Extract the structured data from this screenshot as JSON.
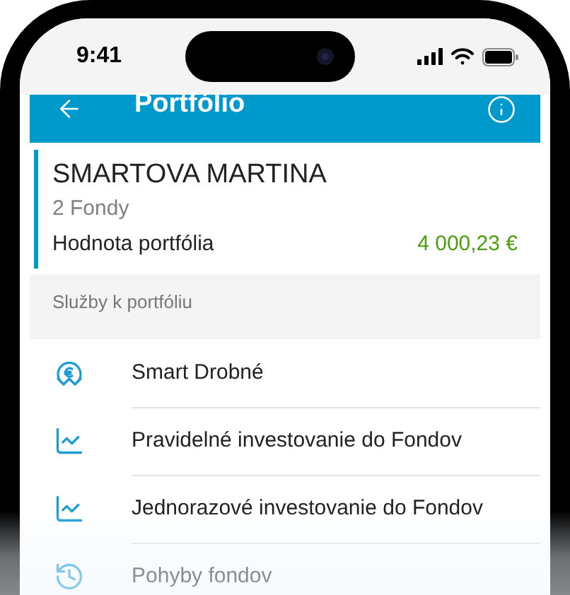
{
  "status_bar": {
    "time": "9:41"
  },
  "header": {
    "title": "Portfólio"
  },
  "portfolio": {
    "owner": "SMARTOVA MARTINA",
    "funds": "2 Fondy",
    "value_label": "Hodnota portfólia",
    "value": "4 000,23 €"
  },
  "services": {
    "heading": "Služby k portfóliu",
    "items": [
      {
        "kind": "euro",
        "label": "Smart Drobné"
      },
      {
        "kind": "chart",
        "label": "Pravidelné investovanie do Fondov"
      },
      {
        "kind": "chart",
        "label": "Jednorazové investovanie do Fondov"
      },
      {
        "kind": "history",
        "label": "Pohyby fondov"
      }
    ]
  }
}
